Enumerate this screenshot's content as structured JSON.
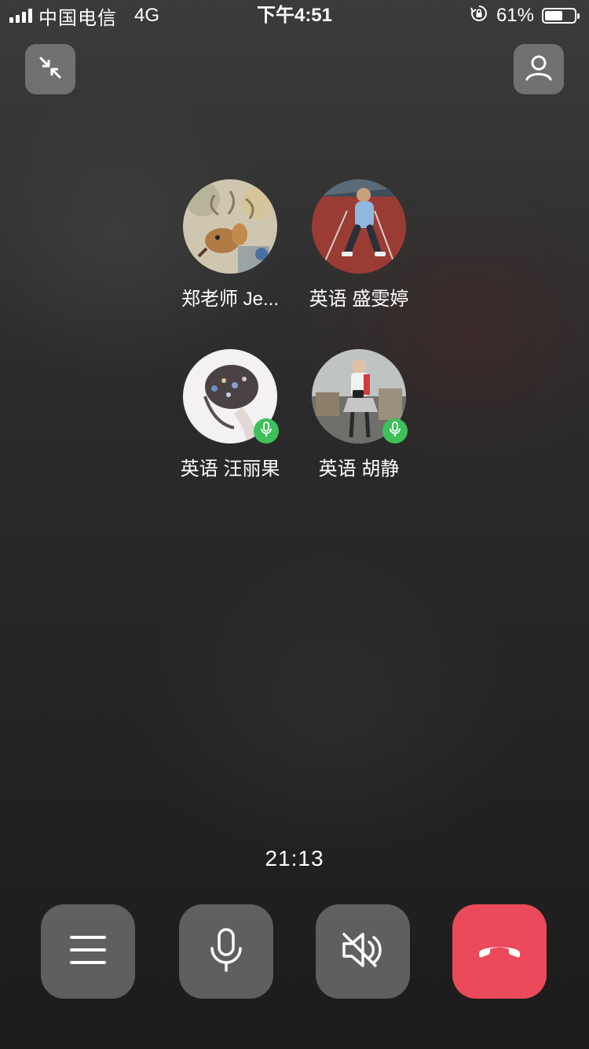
{
  "status_bar": {
    "carrier": "中国电信",
    "network": "4G",
    "time": "下午4:51",
    "battery_percent": "61%",
    "battery_level": 0.61,
    "icons": [
      "signal-icon",
      "rotation-lock-icon",
      "battery-icon"
    ]
  },
  "top_controls": {
    "minimize_icon": "minimize-arrows-icon",
    "add_member_icon": "person-icon"
  },
  "participants": [
    {
      "name": "郑老师 Je...",
      "avatar": "deer-painting-avatar",
      "speaking": false
    },
    {
      "name": "英语 盛雯婷",
      "avatar": "child-on-track-avatar",
      "speaking": false
    },
    {
      "name": "英语 汪丽果",
      "avatar": "hair-flowers-avatar",
      "speaking": true
    },
    {
      "name": "英语 胡静",
      "avatar": "girl-with-bag-avatar",
      "speaking": true
    }
  ],
  "call": {
    "duration": "21:13"
  },
  "bottom_controls": [
    {
      "name": "menu-button",
      "icon": "menu-icon"
    },
    {
      "name": "microphone-button",
      "icon": "microphone-icon"
    },
    {
      "name": "speaker-muted-button",
      "icon": "speaker-mute-icon"
    },
    {
      "name": "hang-up-button",
      "icon": "phone-hangup-icon"
    }
  ],
  "colors": {
    "speaking_badge": "#3ec15a",
    "hangup": "#ea4a5a",
    "control_bg": "#8a8787"
  }
}
